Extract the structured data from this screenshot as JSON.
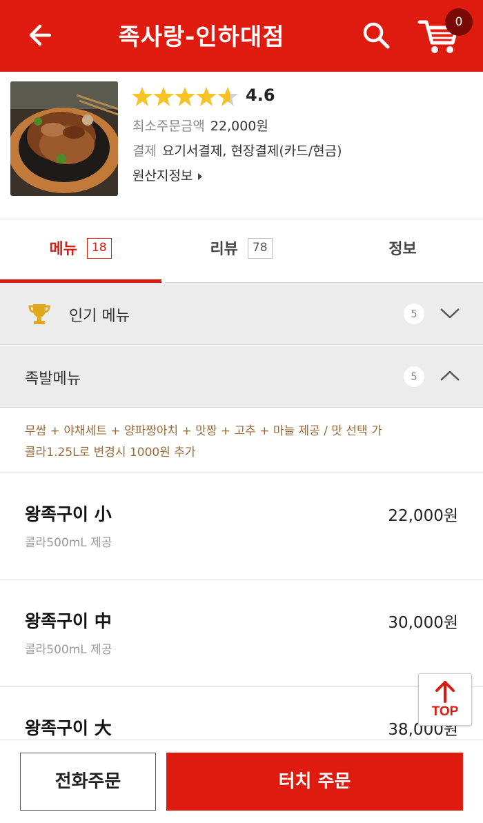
{
  "header": {
    "title": "족사랑-인하대점",
    "cart_count": "0",
    "back_icon": "arrow-left-icon",
    "search_icon": "search-icon",
    "cart_icon": "cart-icon"
  },
  "store": {
    "rating": "4.6",
    "rating_value": 4.6,
    "min_order_label": "최소주문금액",
    "min_order_value": "22,000원",
    "payment_label": "결제",
    "payment_value": "요기서결제, 현장결제(카드/현금)",
    "origin_label": "원산지정보"
  },
  "tabs": [
    {
      "label": "메뉴",
      "count": "18"
    },
    {
      "label": "리뷰",
      "count": "78"
    },
    {
      "label": "정보"
    }
  ],
  "categories": [
    {
      "label": "인기 메뉴",
      "count": "5",
      "icon": "trophy-icon",
      "expanded": false
    },
    {
      "label": "족발메뉴",
      "count": "5",
      "expanded": true
    }
  ],
  "notice": {
    "line1": "무쌈 + 야채세트 + 양파짱아치 + 맛짱 + 고추 + 마늘 제공 /  맛 선택 가",
    "line2": "콜라1.25L로 변경시 1000원 추가"
  },
  "menu_items": [
    {
      "name": "왕족구이 小",
      "desc": "콜라500mL 제공",
      "price": "22,000원"
    },
    {
      "name": "왕족구이 中",
      "desc": "콜라500mL 제공",
      "price": "30,000원"
    },
    {
      "name": "왕족구이 大",
      "price": "38,000원"
    }
  ],
  "top_button": {
    "label": "TOP"
  },
  "bottom": {
    "phone_order": "전화주문",
    "touch_order": "터치 주문"
  },
  "colors": {
    "brand_red": "#df1a0f",
    "star": "#f6c325",
    "notice_text": "#9a6a3a"
  }
}
